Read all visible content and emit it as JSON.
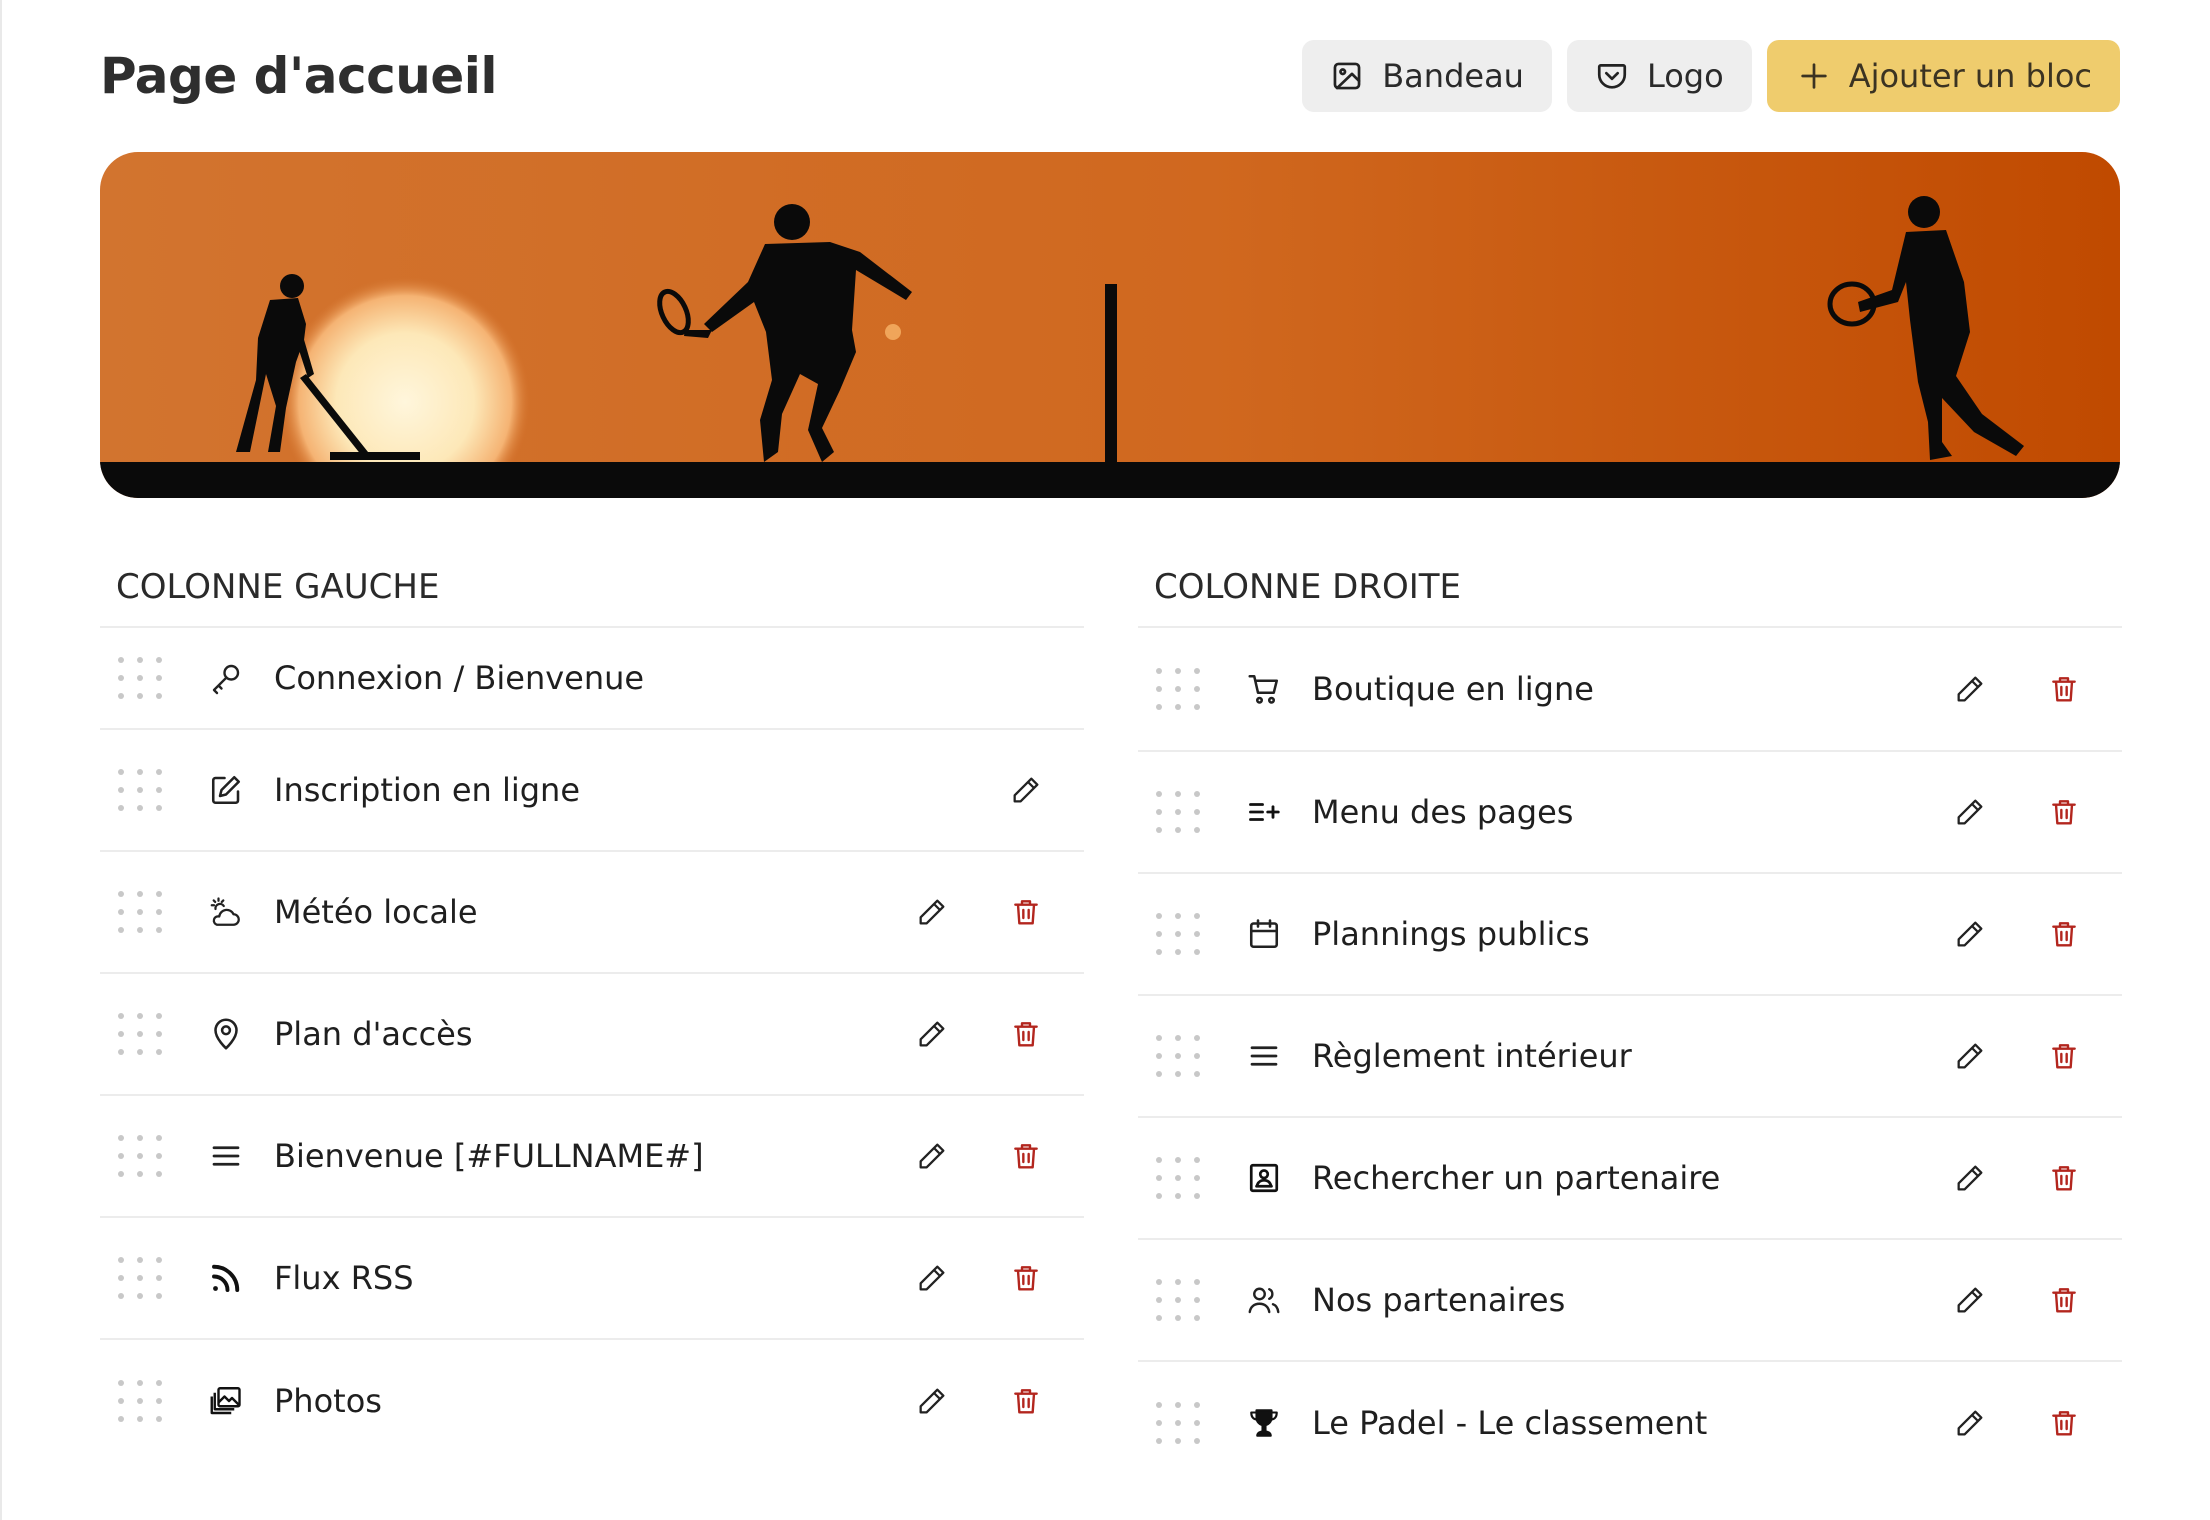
{
  "header": {
    "title": "Page d'accueil",
    "buttons": {
      "bandeau": "Bandeau",
      "logo": "Logo",
      "add_block": "Ajouter un bloc"
    }
  },
  "colors": {
    "accent": "#efcc6d",
    "delete": "#b3261e",
    "banner_orange": "#d2691e",
    "banner_dark": "#c04a00"
  },
  "columns": {
    "left": {
      "title": "COLONNE GAUCHE",
      "items": [
        {
          "label": "Connexion / Bienvenue",
          "icon": "key-icon"
        },
        {
          "label": "Inscription en ligne",
          "icon": "edit-square-icon"
        },
        {
          "label": "Météo locale",
          "icon": "weather-icon"
        },
        {
          "label": "Plan d'accès",
          "icon": "map-pin-icon"
        },
        {
          "label": "Bienvenue [#FULLNAME#]",
          "icon": "menu-lines-icon"
        },
        {
          "label": "Flux RSS",
          "icon": "rss-icon"
        },
        {
          "label": "Photos",
          "icon": "photos-icon"
        }
      ]
    },
    "right": {
      "title": "COLONNE DROITE",
      "items": [
        {
          "label": "Boutique en ligne",
          "icon": "cart-icon"
        },
        {
          "label": "Menu des pages",
          "icon": "list-plus-icon"
        },
        {
          "label": "Plannings publics",
          "icon": "calendar-icon"
        },
        {
          "label": "Règlement intérieur",
          "icon": "menu-lines-icon"
        },
        {
          "label": "Rechercher un partenaire",
          "icon": "contact-card-icon"
        },
        {
          "label": "Nos partenaires",
          "icon": "users-icon"
        },
        {
          "label": "Le Padel - Le classement",
          "icon": "trophy-icon"
        }
      ]
    }
  }
}
